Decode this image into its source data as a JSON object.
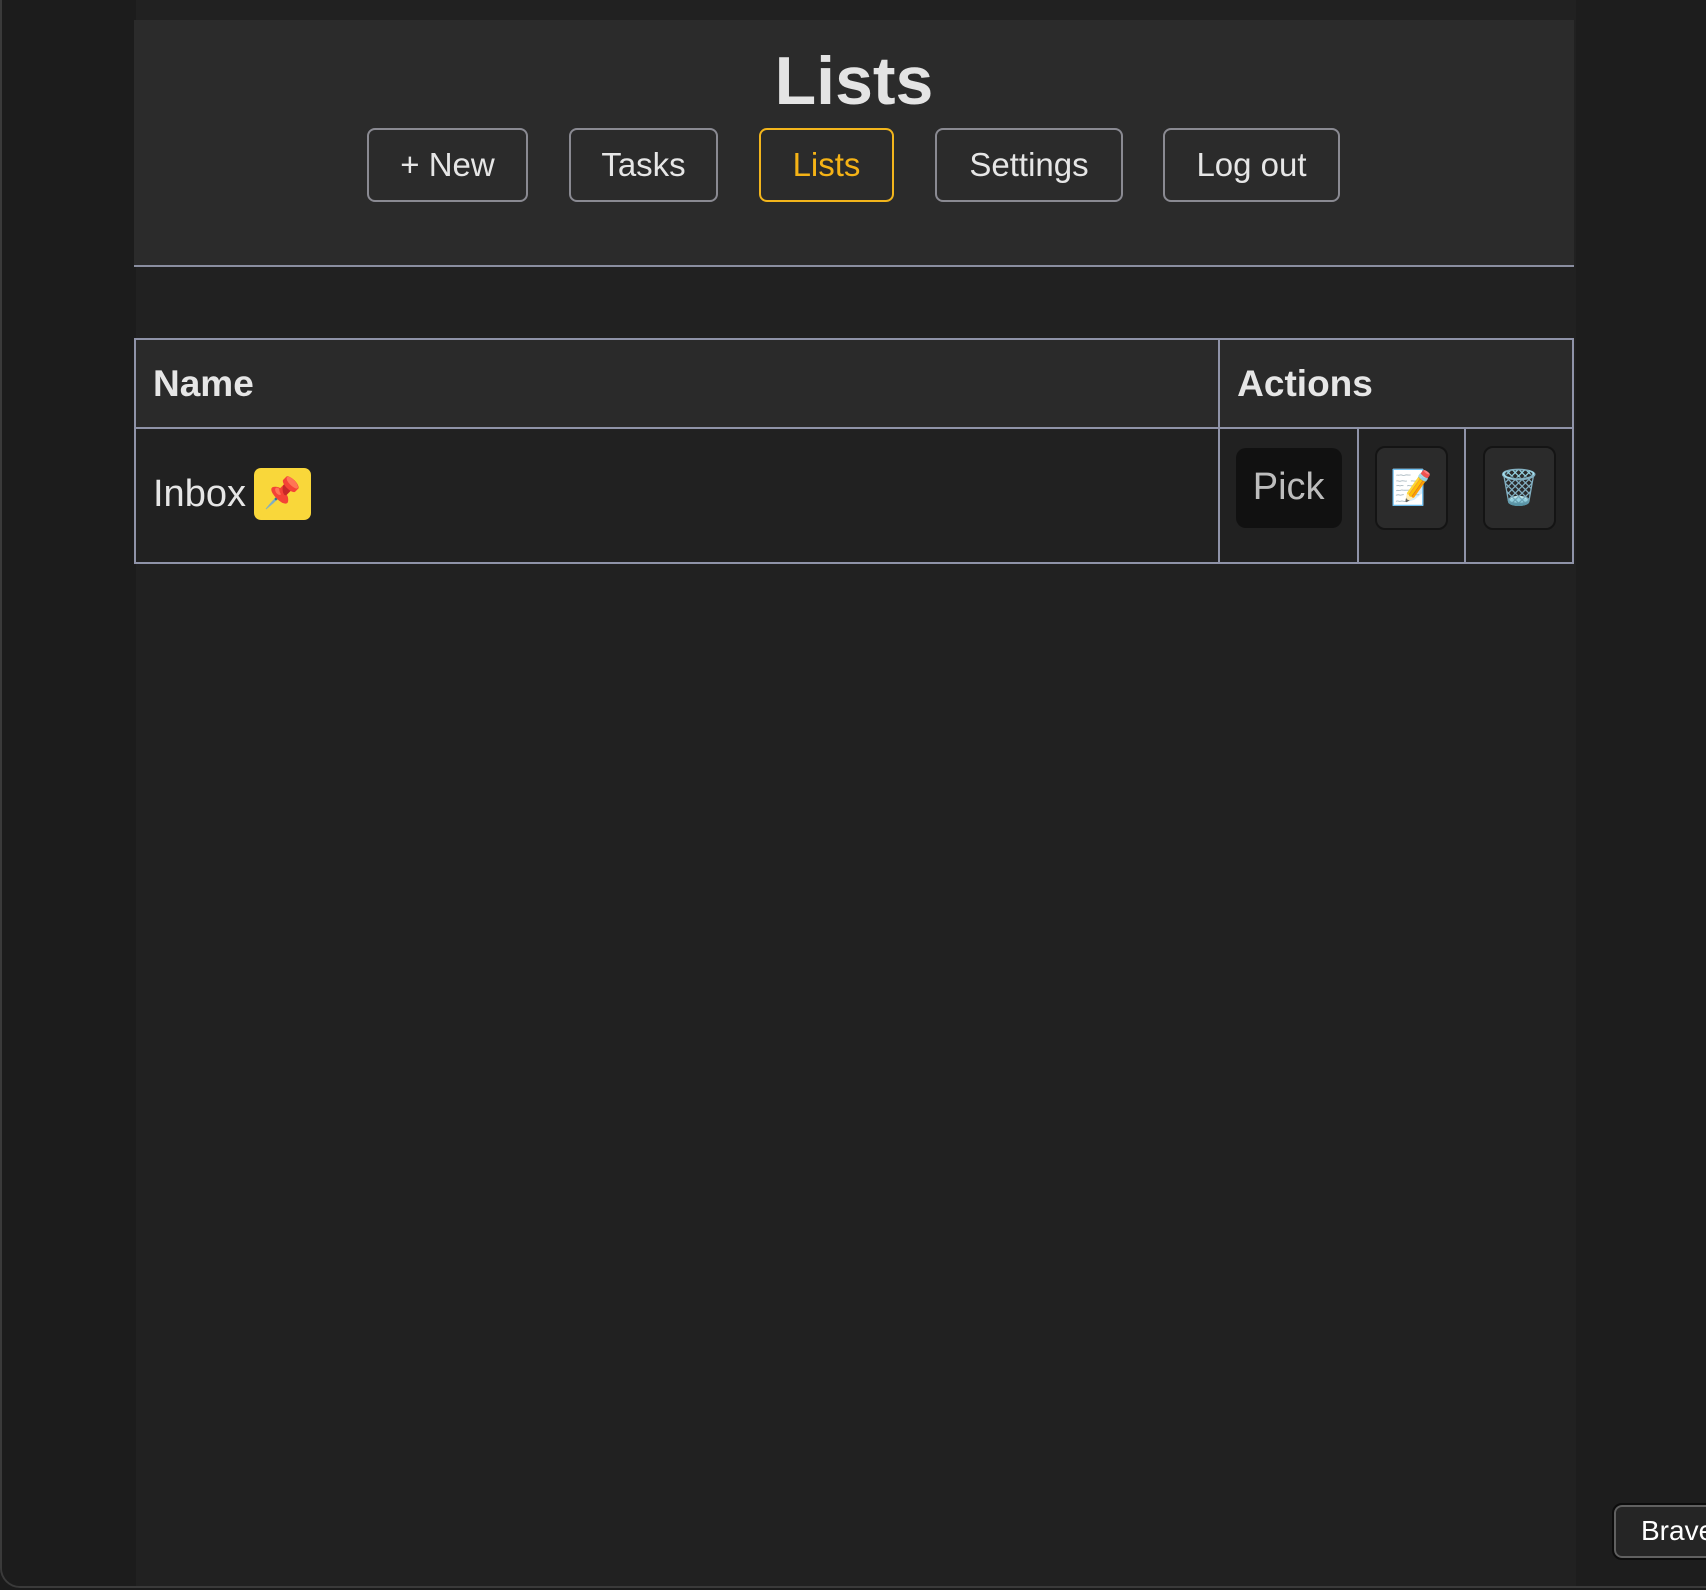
{
  "header": {
    "title": "Lists"
  },
  "nav": [
    {
      "label": "+ New"
    },
    {
      "label": "Tasks"
    },
    {
      "label": "Lists",
      "active": true
    },
    {
      "label": "Settings"
    },
    {
      "label": "Log out"
    }
  ],
  "table": {
    "columns": [
      "Name",
      "Actions"
    ],
    "rows": [
      {
        "name": "Inbox",
        "badge_icon": "📌",
        "pick_label": "Pick",
        "edit_icon": "📝",
        "delete_icon": "🗑️"
      }
    ]
  },
  "browser": {
    "button_label": "Brave"
  },
  "colors": {
    "accent": "#f5b316",
    "badge": "#f9d73a"
  }
}
